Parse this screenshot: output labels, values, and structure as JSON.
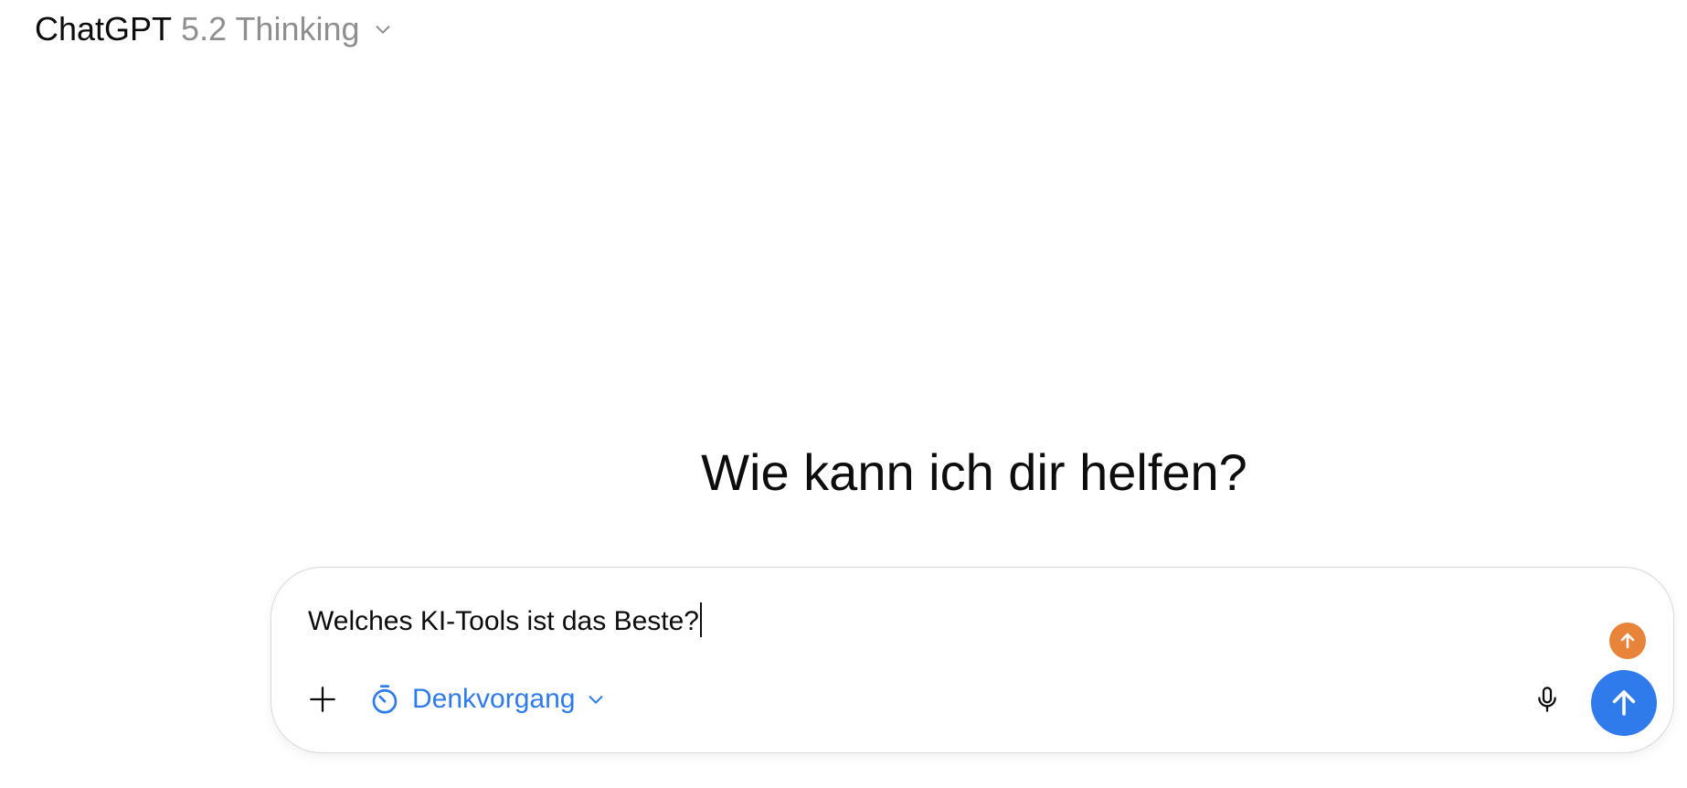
{
  "header": {
    "brand": "ChatGPT",
    "model": "5.2 Thinking",
    "chevron_icon": "chevron-down-icon"
  },
  "main": {
    "greeting": "Wie kann ich dir helfen?"
  },
  "composer": {
    "input_value": "Welches KI-Tools ist das Beste?",
    "add_icon": "plus-icon",
    "thinking_label": "Denkvorgang",
    "thinking_icon": "stopwatch-icon",
    "mic_icon": "microphone-icon",
    "send_icon": "arrow-up-icon",
    "badge_icon": "arrow-up-icon"
  },
  "colors": {
    "accent": "#2f7bec",
    "badge": "#e8833a",
    "text": "#0d0d0d",
    "muted": "#8f8f8f",
    "border": "#d9d9d9"
  }
}
